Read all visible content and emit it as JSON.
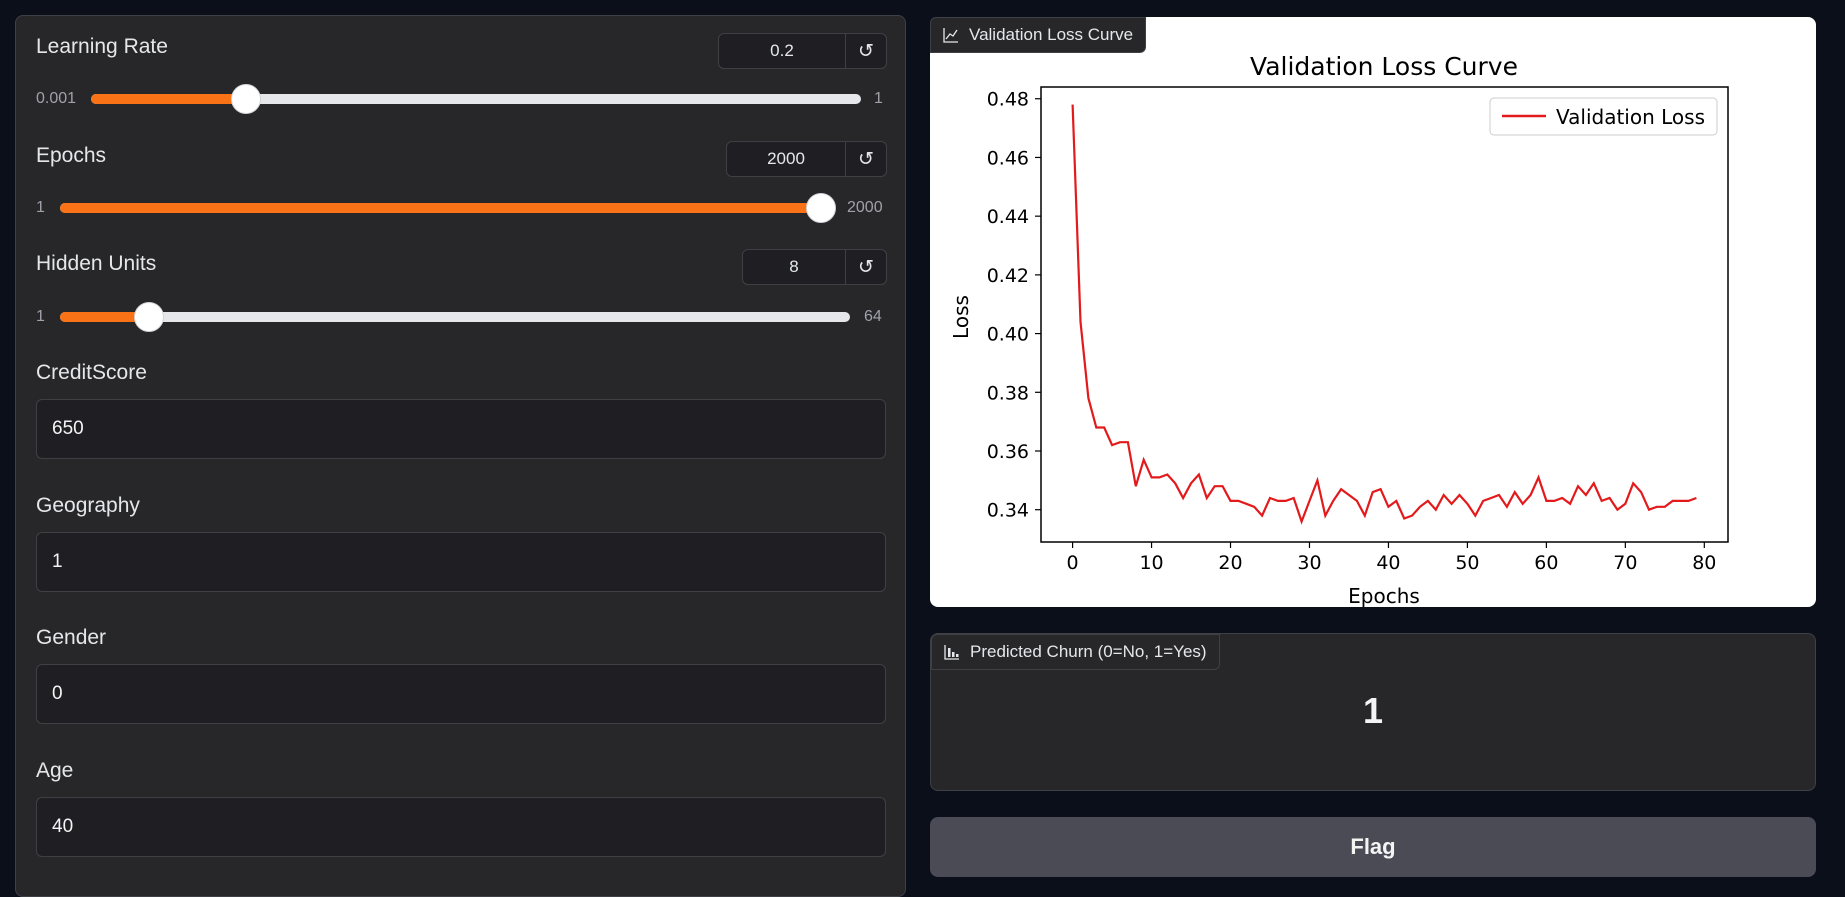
{
  "sliders": [
    {
      "label": "Learning Rate",
      "value": "0.2",
      "min": "0.001",
      "max": "1",
      "fraction": 0.2
    },
    {
      "label": "Epochs",
      "value": "2000",
      "min": "1",
      "max": "2000",
      "fraction": 1.0
    },
    {
      "label": "Hidden Units",
      "value": "8",
      "min": "1",
      "max": "64",
      "fraction": 0.111
    }
  ],
  "reset_glyph": "↺",
  "inputs": [
    {
      "label": "CreditScore",
      "value": "650"
    },
    {
      "label": "Geography",
      "value": "1"
    },
    {
      "label": "Gender",
      "value": "0"
    },
    {
      "label": "Age",
      "value": "40"
    }
  ],
  "plot_block": {
    "label": "Validation Loss Curve",
    "icon": "line-chart-icon"
  },
  "output_block": {
    "label": "Predicted Churn (0=No, 1=Yes)",
    "icon": "bar-chart-icon",
    "value": "1"
  },
  "flag_button": {
    "label": "Flag"
  },
  "colors": {
    "accent": "#f97316",
    "series": "#e31a1c"
  },
  "chart_data": {
    "type": "line",
    "title": "Validation Loss Curve",
    "xlabel": "Epochs",
    "ylabel": "Loss",
    "xlim": [
      -4,
      83
    ],
    "ylim": [
      0.329,
      0.484
    ],
    "xticks": [
      "0",
      "10",
      "20",
      "30",
      "40",
      "50",
      "60",
      "70",
      "80"
    ],
    "yticks": [
      "0.34",
      "0.36",
      "0.38",
      "0.40",
      "0.42",
      "0.44",
      "0.46",
      "0.48"
    ],
    "legend_position": "top-right",
    "grid": false,
    "series": [
      {
        "name": "Validation Loss",
        "x": [
          0,
          1,
          2,
          3,
          4,
          5,
          6,
          7,
          8,
          9,
          10,
          11,
          12,
          13,
          14,
          15,
          16,
          17,
          18,
          19,
          20,
          21,
          22,
          23,
          24,
          25,
          26,
          27,
          28,
          29,
          30,
          31,
          32,
          33,
          34,
          35,
          36,
          37,
          38,
          39,
          40,
          41,
          42,
          43,
          44,
          45,
          46,
          47,
          48,
          49,
          50,
          51,
          52,
          53,
          54,
          55,
          56,
          57,
          58,
          59,
          60,
          61,
          62,
          63,
          64,
          65,
          66,
          67,
          68,
          69,
          70,
          71,
          72,
          73,
          74,
          75,
          76,
          77,
          78,
          79
        ],
        "y": [
          0.478,
          0.404,
          0.378,
          0.368,
          0.368,
          0.362,
          0.363,
          0.363,
          0.348,
          0.357,
          0.351,
          0.351,
          0.352,
          0.349,
          0.344,
          0.349,
          0.352,
          0.344,
          0.348,
          0.348,
          0.343,
          0.343,
          0.342,
          0.341,
          0.338,
          0.344,
          0.343,
          0.343,
          0.344,
          0.336,
          0.343,
          0.35,
          0.338,
          0.343,
          0.347,
          0.345,
          0.343,
          0.338,
          0.346,
          0.347,
          0.341,
          0.343,
          0.337,
          0.338,
          0.341,
          0.343,
          0.34,
          0.345,
          0.342,
          0.345,
          0.342,
          0.338,
          0.343,
          0.344,
          0.345,
          0.341,
          0.346,
          0.342,
          0.345,
          0.351,
          0.343,
          0.343,
          0.344,
          0.342,
          0.348,
          0.345,
          0.349,
          0.343,
          0.344,
          0.34,
          0.342,
          0.349,
          0.346,
          0.34,
          0.341,
          0.341,
          0.343,
          0.343,
          0.343,
          0.344
        ]
      }
    ]
  }
}
